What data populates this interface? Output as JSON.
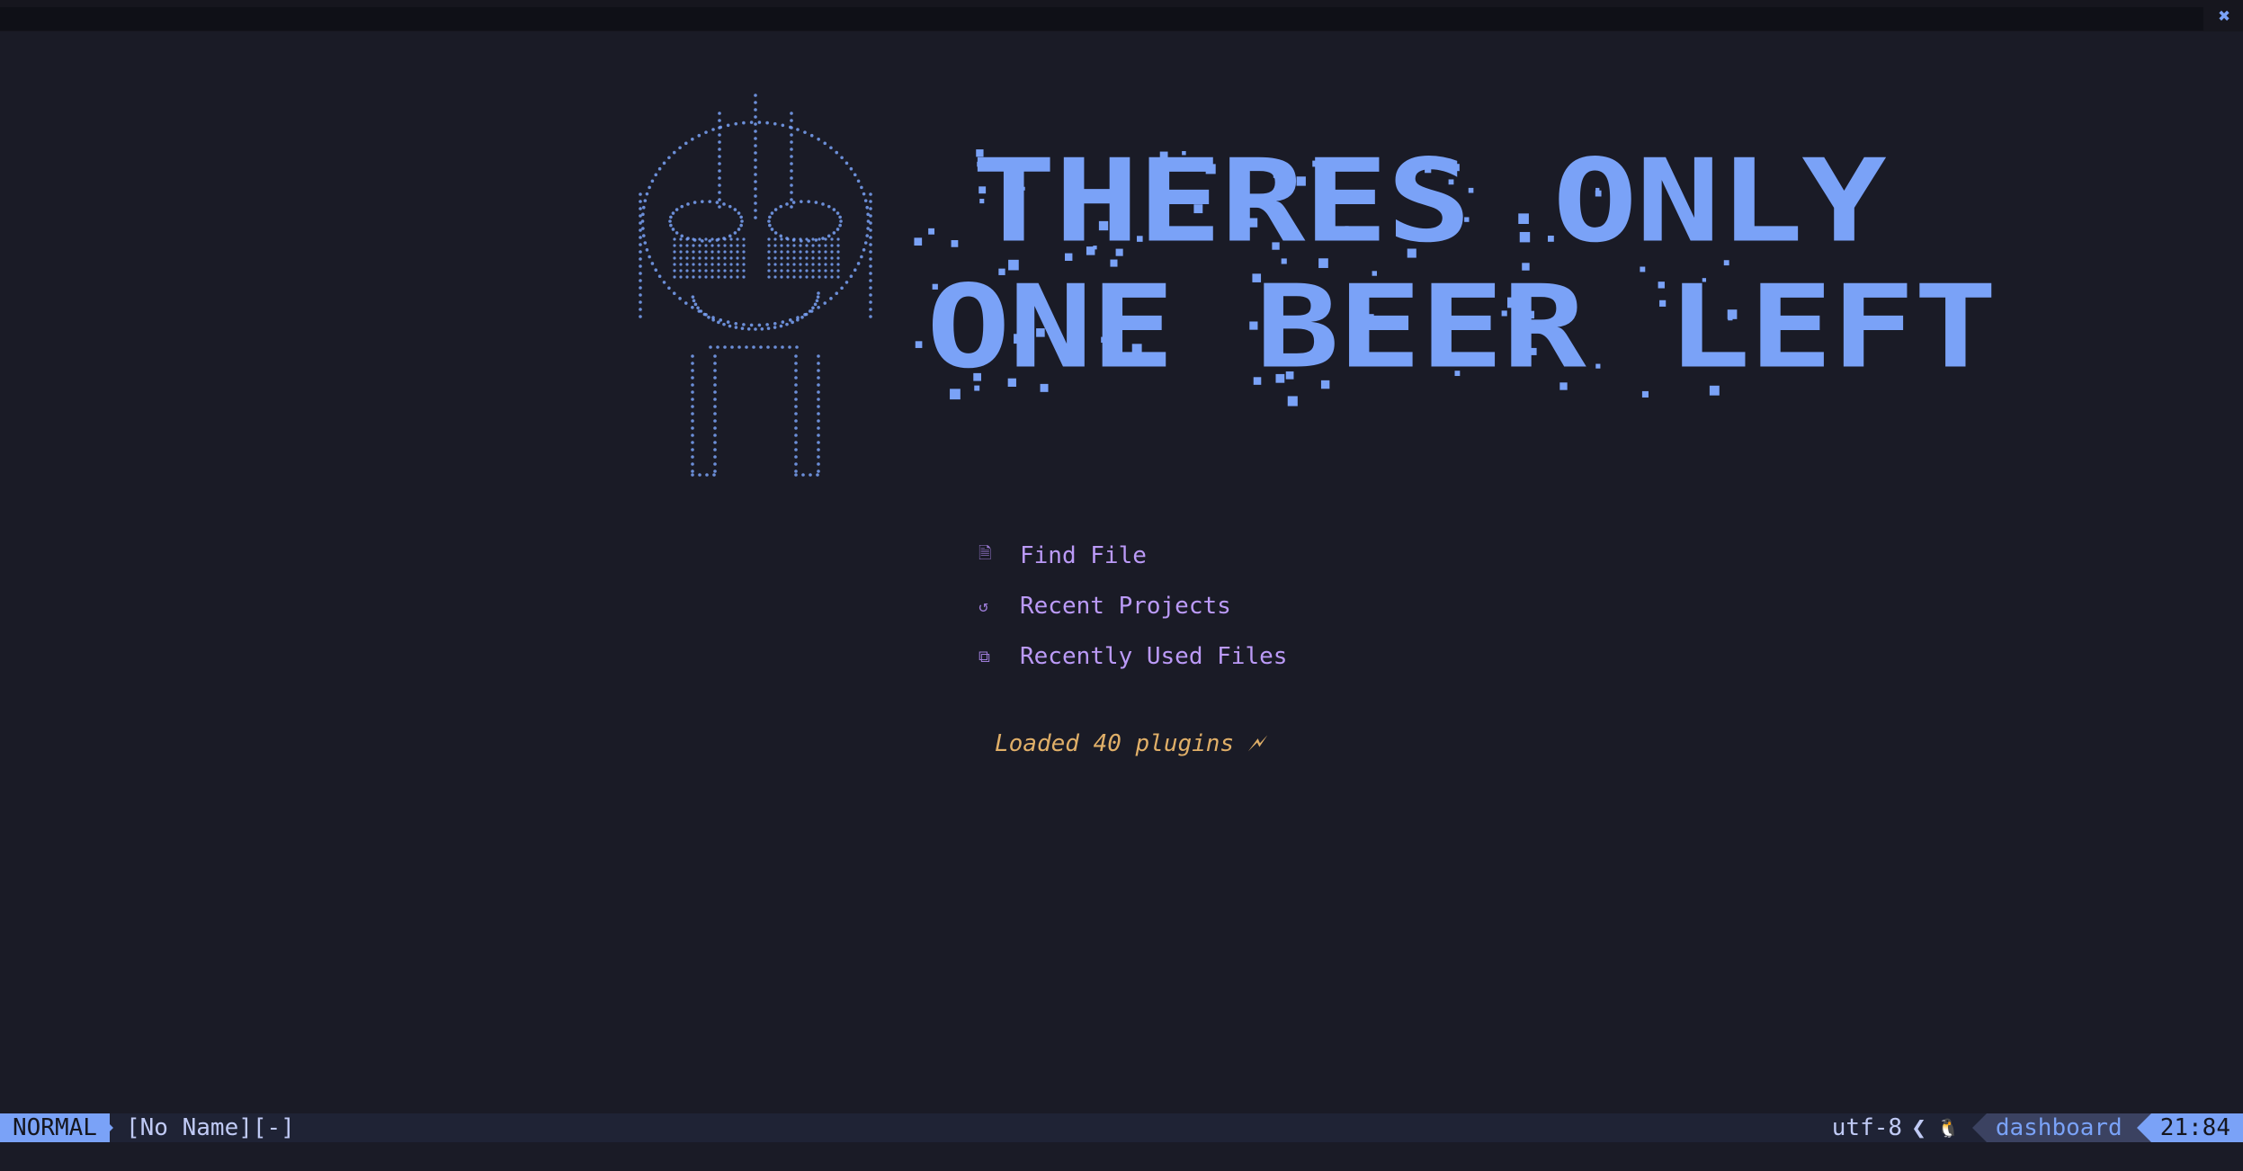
{
  "tabline": {
    "close_icon": "close-icon",
    "close_glyph": "✖"
  },
  "header": {
    "title_line1": "THERES ONLY",
    "title_line2": "ONE BEER LEFT",
    "color": "#7aa2f7"
  },
  "menu": {
    "items": [
      {
        "icon": "file-icon",
        "glyph": "🗎",
        "label": "Find File"
      },
      {
        "icon": "history-icon",
        "glyph": "↺",
        "label": "Recent Projects"
      },
      {
        "icon": "files-icon",
        "glyph": "⧉",
        "label": "Recently Used Files"
      }
    ]
  },
  "footer": {
    "text": "Loaded 40 plugins 🗲"
  },
  "statusline": {
    "mode": "NORMAL",
    "filename": "[No Name][-]",
    "encoding": "utf-8",
    "separator": "❮",
    "os_icon": "linux-icon",
    "os_glyph": "🐧",
    "filetype": "dashboard",
    "position": "21:84"
  },
  "colors": {
    "background": "#1a1b26",
    "accent": "#7aa2f7",
    "menu": "#bb9af7",
    "footer": "#e0af68"
  }
}
